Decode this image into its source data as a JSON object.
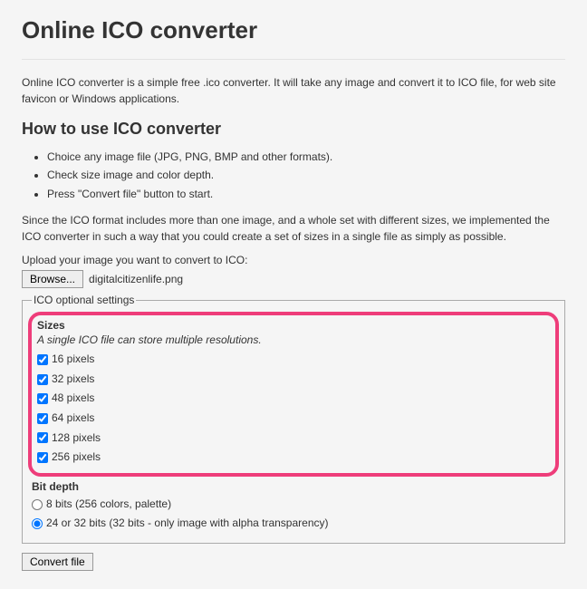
{
  "title": "Online ICO converter",
  "intro": "Online ICO converter is a simple free .ico converter. It will take any image and convert it to ICO file, for web site favicon or Windows applications.",
  "howto_title": "How to use ICO converter",
  "steps": [
    "Choice any image file (JPG, PNG, BMP and other formats).",
    "Check size image and color depth.",
    "Press \"Convert file\" button to start."
  ],
  "since_text": "Since the ICO format includes more than one image, and a whole set with different sizes, we implemented the ICO converter in such a way that you could create a set of sizes in a single file as simply as possible.",
  "upload_label": "Upload your image you want to convert to ICO:",
  "browse_label": "Browse...",
  "filename": "digitalcitizenlife.png",
  "fieldset_legend": "ICO optional settings",
  "sizes_head": "Sizes",
  "sizes_sub": "A single ICO file can store multiple resolutions.",
  "sizes": [
    {
      "label": "16 pixels",
      "checked": true
    },
    {
      "label": "32 pixels",
      "checked": true
    },
    {
      "label": "48 pixels",
      "checked": true
    },
    {
      "label": "64 pixels",
      "checked": true
    },
    {
      "label": "128 pixels",
      "checked": true
    },
    {
      "label": "256 pixels",
      "checked": true
    }
  ],
  "bitdepth_head": "Bit depth",
  "bitdepth": [
    {
      "label": "8 bits (256 colors, palette)",
      "checked": false
    },
    {
      "label": "24 or 32 bits (32 bits - only image with alpha transparency)",
      "checked": true
    }
  ],
  "convert_label": "Convert file"
}
